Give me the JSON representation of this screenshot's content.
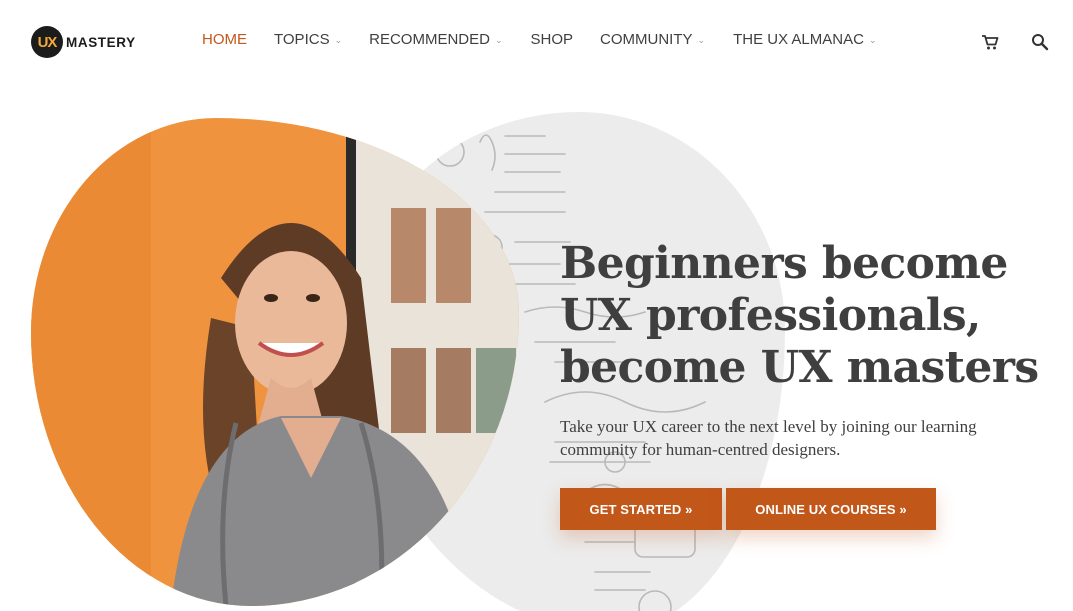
{
  "logo": {
    "badge": "UX",
    "text": "MASTERY"
  },
  "nav": {
    "items": [
      {
        "label": "HOME",
        "active": true,
        "dropdown": false
      },
      {
        "label": "TOPICS",
        "dropdown": true
      },
      {
        "label": "RECOMMENDED",
        "dropdown": true
      },
      {
        "label": "SHOP",
        "dropdown": false
      },
      {
        "label": "COMMUNITY",
        "dropdown": true
      },
      {
        "label": "THE UX ALMANAC",
        "dropdown": true
      }
    ],
    "chevron": "⌄"
  },
  "icons": {
    "cart": "cart-icon",
    "search": "search-icon"
  },
  "hero": {
    "headline_line1": "Beginners become",
    "headline_line2": "UX professionals,",
    "headline_line3": "become UX masters",
    "subtext": "Take your UX career to the next level by joining our learning community for human-centred designers.",
    "cta_primary": "GET STARTED »",
    "cta_secondary": "ONLINE UX COURSES »"
  },
  "colors": {
    "accent": "#c2571a",
    "text": "#3f3f3f",
    "photo_background": "#f0933f",
    "blob": "#ececec"
  }
}
